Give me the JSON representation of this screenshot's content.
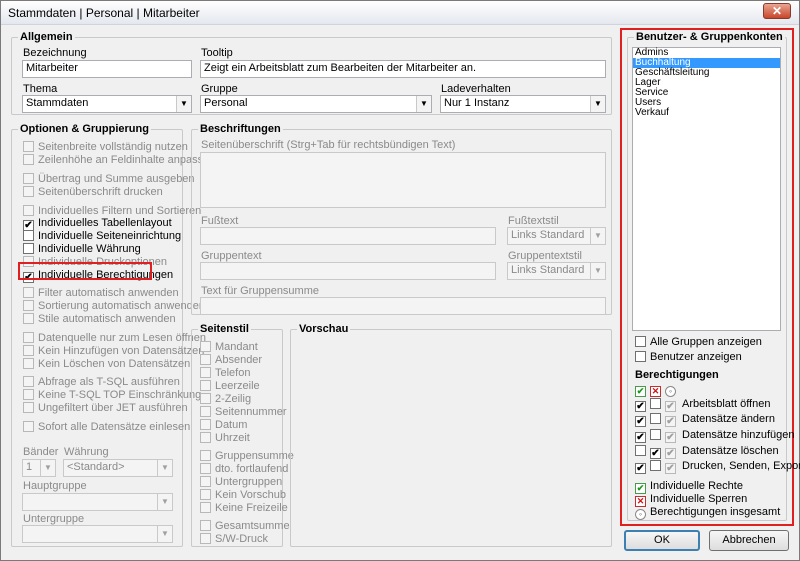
{
  "window": {
    "title": "Stammdaten | Personal | Mitarbeiter",
    "close_label": "✕"
  },
  "allgemein": {
    "title": "Allgemein",
    "bezeichnung_label": "Bezeichnung",
    "bezeichnung_value": "Mitarbeiter",
    "tooltip_label": "Tooltip",
    "tooltip_value": "Zeigt ein Arbeitsblatt zum Bearbeiten der Mitarbeiter an.",
    "thema_label": "Thema",
    "thema_value": "Stammdaten",
    "gruppe_label": "Gruppe",
    "gruppe_value": "Personal",
    "ladeverhalten_label": "Ladeverhalten",
    "ladeverhalten_value": "Nur 1 Instanz"
  },
  "optionen": {
    "title": "Optionen & Gruppierung",
    "items": [
      {
        "label": "Seitenbreite vollständig nutzen",
        "checked": false,
        "enabled": false
      },
      {
        "label": "Zeilenhöhe an Feldinhalte anpassen",
        "checked": false,
        "enabled": false
      },
      {
        "label": "Übertrag und Summe ausgeben",
        "checked": false,
        "enabled": false
      },
      {
        "label": "Seitenüberschrift drucken",
        "checked": false,
        "enabled": false
      },
      {
        "label": "Individuelles Filtern und Sortieren",
        "checked": false,
        "enabled": false
      },
      {
        "label": "Individuelles Tabellenlayout",
        "checked": true,
        "enabled": true
      },
      {
        "label": "Individuelle Seiteneinrichtung",
        "checked": false,
        "enabled": true
      },
      {
        "label": "Individuelle Währung",
        "checked": false,
        "enabled": true
      },
      {
        "label": "Individuelle Druckoptionen",
        "checked": false,
        "enabled": false
      },
      {
        "label": "Individuelle Berechtigungen",
        "checked": true,
        "enabled": true
      },
      {
        "label": "Filter automatisch anwenden",
        "checked": false,
        "enabled": false
      },
      {
        "label": "Sortierung automatisch anwenden",
        "checked": false,
        "enabled": false
      },
      {
        "label": "Stile automatisch anwenden",
        "checked": false,
        "enabled": false
      },
      {
        "label": "Datenquelle nur zum Lesen öffnen",
        "checked": false,
        "enabled": false
      },
      {
        "label": "Kein Hinzufügen von Datensätzen",
        "checked": false,
        "enabled": false
      },
      {
        "label": "Kein Löschen von Datensätzen",
        "checked": false,
        "enabled": false
      },
      {
        "label": "Abfrage als T-SQL ausführen",
        "checked": false,
        "enabled": false
      },
      {
        "label": "Keine T-SQL TOP Einschränkung",
        "checked": false,
        "enabled": false
      },
      {
        "label": "Ungefiltert über JET ausführen",
        "checked": false,
        "enabled": false
      },
      {
        "label": "Sofort alle Datensätze einlesen",
        "checked": false,
        "enabled": false
      }
    ],
    "baender_label": "Bänder",
    "baender_value": "1",
    "waehrung_label": "Währung",
    "waehrung_value": "<Standard>",
    "hauptgruppe_label": "Hauptgruppe",
    "untergruppe_label": "Untergruppe"
  },
  "beschriftungen": {
    "title": "Beschriftungen",
    "seitenueberschrift_label": "Seitenüberschrift (Strg+Tab für rechtsbündigen Text)",
    "fusstext_label": "Fußtext",
    "fusstextstil_label": "Fußtextstil",
    "fusstextstil_value": "Links Standard",
    "gruppentext_label": "Gruppentext",
    "gruppentextstil_label": "Gruppentextstil",
    "gruppentextstil_value": "Links Standard",
    "gruppensumme_label": "Text für Gruppensumme"
  },
  "seitenstil": {
    "title": "Seitenstil",
    "items": [
      "Mandant",
      "Absender",
      "Telefon",
      "Leerzeile",
      "2-Zeilig",
      "Seitennummer",
      "Datum",
      "Uhrzeit",
      "Gruppensumme",
      "dto. fortlaufend",
      "Untergruppen",
      "Kein Vorschub",
      "Keine Freizeile",
      "Gesamtsumme",
      "S/W-Druck"
    ]
  },
  "vorschau": {
    "title": "Vorschau"
  },
  "benutzer": {
    "title": "Benutzer- & Gruppenkonten",
    "accounts": [
      "Admins",
      "Buchhaltung",
      "Geschäftsleitung",
      "Lager",
      "Service",
      "Users",
      "Verkauf"
    ],
    "selected_index": 1,
    "alle_gruppen_label": "Alle Gruppen anzeigen",
    "benutzer_anzeigen_label": "Benutzer anzeigen"
  },
  "berechtigungen": {
    "title": "Berechtigungen",
    "rows": [
      {
        "label": "Arbeitsblatt öffnen",
        "c1": "✔",
        "c2": "",
        "c3": "✔"
      },
      {
        "label": "Datensätze ändern",
        "c1": "✔",
        "c2": "",
        "c3": "✔"
      },
      {
        "label": "Datensätze hinzufügen",
        "c1": "✔",
        "c2": "",
        "c3": "✔"
      },
      {
        "label": "Datensätze löschen",
        "c1": "",
        "c2": "✔",
        "c3": "✔"
      },
      {
        "label": "Drucken, Senden, Export",
        "c1": "✔",
        "c2": "",
        "c3": "✔"
      }
    ],
    "legend": [
      {
        "label": "Individuelle Rechte",
        "icon": "green-check-icon"
      },
      {
        "label": "Individuelle Sperren",
        "icon": "red-x-icon"
      },
      {
        "label": "Berechtigungen insgesamt",
        "icon": "ring-icon"
      }
    ]
  },
  "buttons": {
    "ok": "OK",
    "abbrechen": "Abbrechen"
  },
  "colors": {
    "highlight": "#e02020",
    "selection": "#3399ff"
  }
}
